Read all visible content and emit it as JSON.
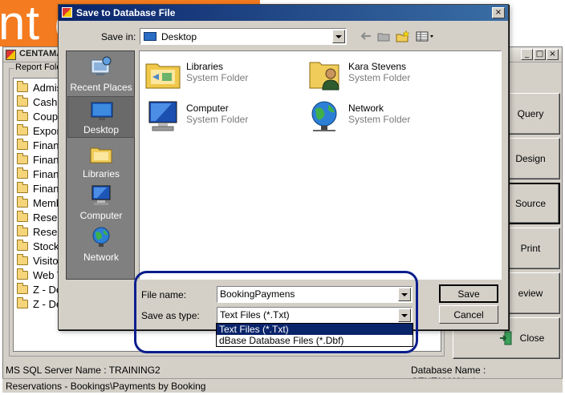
{
  "background_app": {
    "banner_text": "nt cA",
    "window_title": "CENTAMAN",
    "window_buttons": [
      "_",
      "□",
      "×"
    ],
    "report_folders_label": "Report Fold",
    "folders": [
      "Admis",
      "Cashi",
      "Coupo",
      "Expor",
      "Finan",
      "Finan",
      "Finan",
      "Finan",
      "Memb",
      "Rese",
      "Rese",
      "Stock",
      "Visito",
      "Web T",
      "Z - De",
      "Z - De"
    ],
    "side_buttons": {
      "query": "Query",
      "design": "Design",
      "source": "Source",
      "print": "Print",
      "preview": "eview",
      "close": "Close"
    },
    "server_name": "MS SQL Server Name : TRAINING2",
    "database_name": "Database Name : CENTAMAN_demo",
    "status_path": "Reservations - Bookings\\Payments by Booking"
  },
  "dialog": {
    "title": "Save to Database File",
    "close_glyph": "×",
    "save_in_label": "Save in:",
    "save_in_value": "Desktop",
    "places": [
      "Recent Places",
      "Desktop",
      "Libraries",
      "Computer",
      "Network"
    ],
    "items": [
      {
        "name": "Libraries",
        "type": "System Folder"
      },
      {
        "name": "Kara Stevens",
        "type": "System Folder"
      },
      {
        "name": "Computer",
        "type": "System Folder"
      },
      {
        "name": "Network",
        "type": "System Folder"
      }
    ],
    "file_name_label": "File name:",
    "file_name_value": "BookingPaymens",
    "save_as_type_label": "Save as type:",
    "save_as_type_value": "Text Files (*.Txt)",
    "type_options": [
      "Text Files (*.Txt)",
      "dBase Database Files (*.Dbf)"
    ],
    "save_button": "Save",
    "cancel_button": "Cancel"
  },
  "colors": {
    "banner": "#f47b20",
    "titlebar": "#0a246a",
    "selection": "#0a246a",
    "highlight_ring": "#0a1e8c",
    "places_bar": "#808080"
  }
}
